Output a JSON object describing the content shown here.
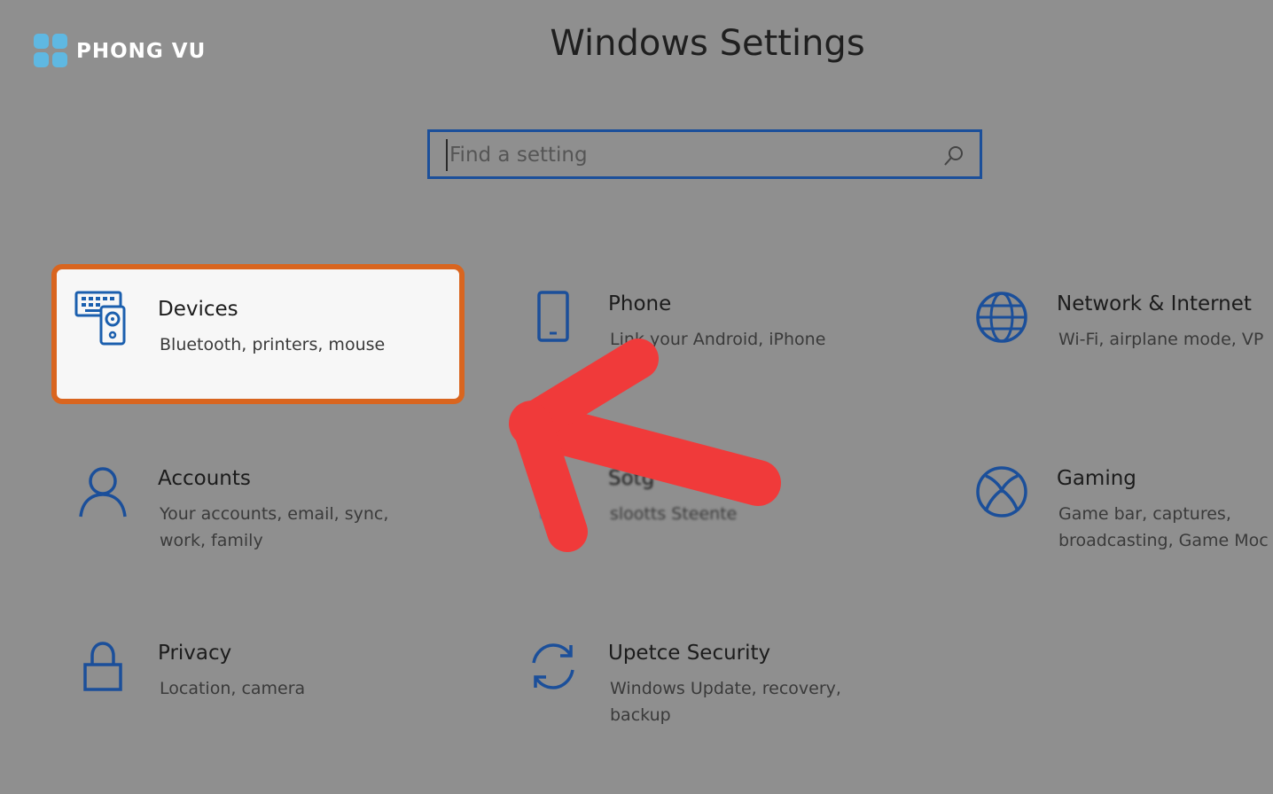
{
  "brand": {
    "name": "PHONG VU",
    "logo_color": "#5fb8e2"
  },
  "window": {
    "title": "Windows Settings"
  },
  "search": {
    "placeholder": "Find a setting",
    "value": "",
    "icon": "search-icon"
  },
  "colors": {
    "accent": "#1b4f9a",
    "highlight": "#d9651f",
    "arrow": "#f03a3a",
    "background": "#8f8f8f"
  },
  "tiles": [
    {
      "id": "devices",
      "label": "Devices",
      "description": "Bluetooth, printers, mouse",
      "icon": "devices-icon",
      "highlighted": true
    },
    {
      "id": "phone",
      "label": "Phone",
      "description": "Link your Android, iPhone",
      "icon": "phone-icon"
    },
    {
      "id": "network",
      "label": "Network & Internet",
      "description": "Wi-Fi, airplane mode, VP",
      "icon": "globe-icon"
    },
    {
      "id": "accounts",
      "label": "Accounts",
      "description": "Your accounts, email, sync, work, family",
      "icon": "person-icon"
    },
    {
      "id": "time",
      "label": "Sotg",
      "description": "slootts Steente",
      "icon": "time-language-icon"
    },
    {
      "id": "gaming",
      "label": "Gaming",
      "description": "Game bar, captures, broadcasting, Game Moc",
      "icon": "xbox-icon"
    },
    {
      "id": "privacy",
      "label": "Privacy",
      "description": "Location, camera",
      "icon": "lock-icon"
    },
    {
      "id": "update",
      "label": "Upetce Security",
      "description": "Windows Update, recovery, backup",
      "icon": "refresh-icon"
    }
  ]
}
